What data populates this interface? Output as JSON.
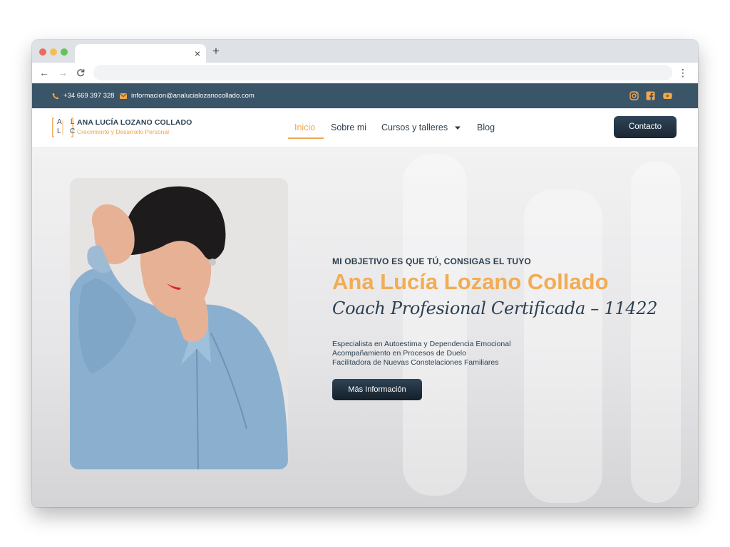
{
  "browser": {
    "tab_close": "×",
    "new_tab": "+",
    "back": "←",
    "forward": "→",
    "reload": "C",
    "menu": "⋮",
    "traffic_colors": [
      "#ed6a5e",
      "#f5bf4f",
      "#61c554"
    ]
  },
  "topbar": {
    "phone": "+34 669 397 328",
    "email": "informacion@analucialozanocollado.com",
    "icons": [
      "phone-icon",
      "mail-icon",
      "instagram-icon",
      "facebook-icon",
      "youtube-icon"
    ],
    "accent": "#f0a84c",
    "background": "#3a5468"
  },
  "logo": {
    "mark_top": "A L",
    "mark_bottom": "L C",
    "name": "ANA LUCÍA LOZANO COLLADO",
    "tagline": "Crecimiento y Desarrollo Personal"
  },
  "nav": {
    "items": [
      {
        "label": "Inicio",
        "active": true
      },
      {
        "label": "Sobre mi"
      },
      {
        "label": "Cursos y talleres"
      },
      {
        "label": "Blog"
      }
    ],
    "contact": "Contacto"
  },
  "hero": {
    "eyebrow": "MI OBJETIVO ES QUE TÚ, CONSIGAS EL TUYO",
    "title": "Ana Lucía Lozano Collado",
    "subtitle": "Coach Profesional Certificada – 11422",
    "lines": [
      "Especialista en Autoestima y Dependencia Emocional",
      "Acompañamiento en Procesos de Duelo",
      "Facilitadora de Nuevas Constelaciones Familiares"
    ],
    "button": "Más Información"
  }
}
